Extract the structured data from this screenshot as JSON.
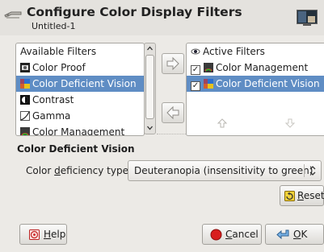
{
  "header": {
    "title": "Configure Color Display Filters",
    "subtitle": "Untitled-1"
  },
  "available": {
    "title": "Available Filters",
    "items": [
      {
        "label": "Color Proof",
        "icon": "color-proof-icon",
        "selected": false
      },
      {
        "label": "Color Deficient Vision",
        "icon": "color-deficient-icon",
        "selected": true
      },
      {
        "label": "Contrast",
        "icon": "contrast-icon",
        "selected": false
      },
      {
        "label": "Gamma",
        "icon": "gamma-icon",
        "selected": false
      },
      {
        "label": "Color Management",
        "icon": "color-management-icon",
        "selected": false
      }
    ]
  },
  "active": {
    "title": "Active Filters",
    "items": [
      {
        "label": "Color Management",
        "checked": true,
        "selected": false
      },
      {
        "label": "Color Deficient Vision",
        "checked": true,
        "selected": true
      }
    ]
  },
  "section": {
    "title": "Color Deficient Vision",
    "deficiency_label_pre": "Color ",
    "deficiency_label_mnemonic": "d",
    "deficiency_label_post": "eficiency type:",
    "deficiency_value": "Deuteranopia (insensitivity to green)"
  },
  "buttons": {
    "reset_mnemonic": "R",
    "reset_rest": "eset",
    "help_mnemonic": "H",
    "help_rest": "elp",
    "cancel_mnemonic": "C",
    "cancel_rest": "ancel",
    "ok_mnemonic": "O",
    "ok_rest": "K"
  },
  "colors": {
    "selection": "#5f8dc4",
    "background": "#eceae6"
  }
}
